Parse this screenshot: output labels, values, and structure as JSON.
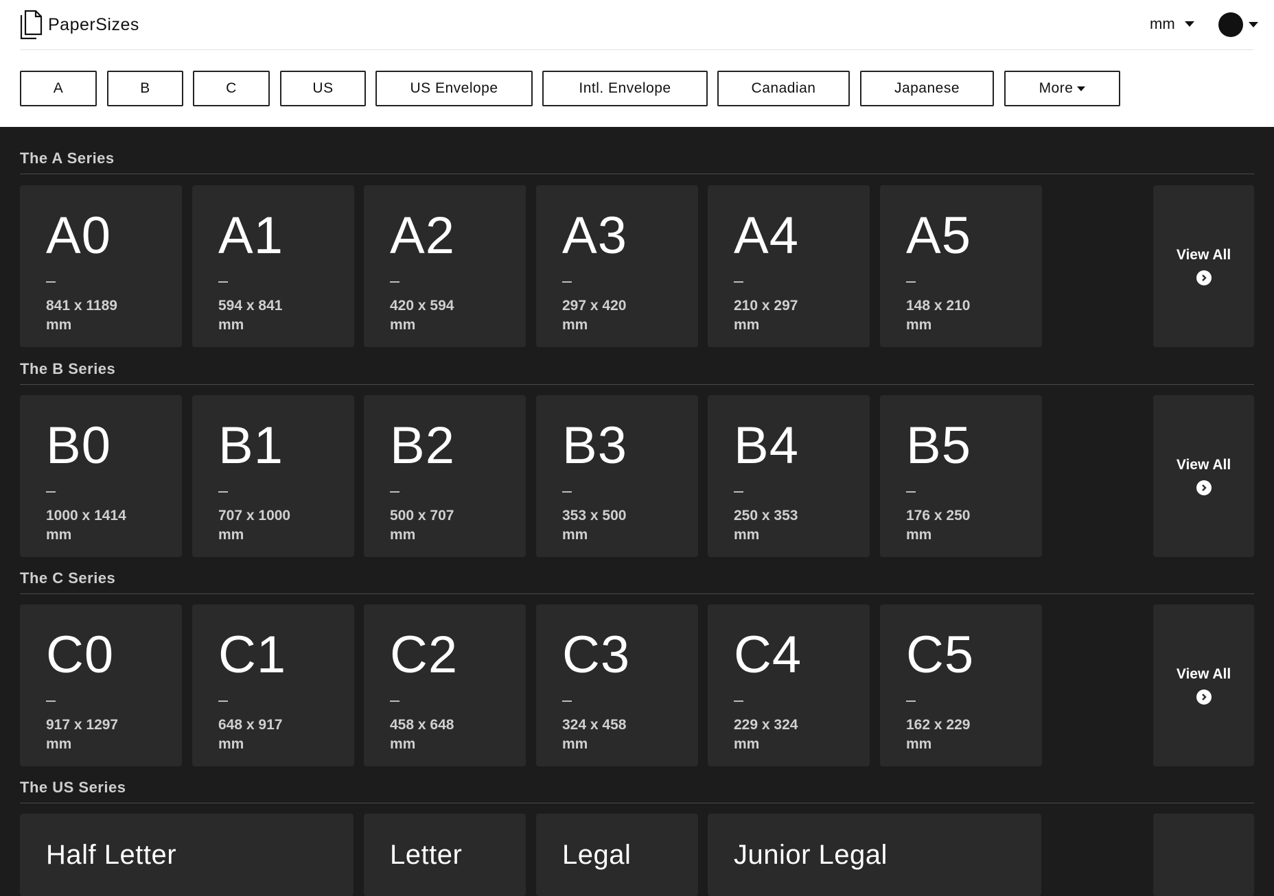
{
  "app": {
    "name": "PaperSizes"
  },
  "header": {
    "unit": "mm",
    "avatar_label": ""
  },
  "nav": [
    "A",
    "B",
    "C",
    "US",
    "US Envelope",
    "Intl. Envelope",
    "Canadian",
    "Japanese",
    "More"
  ],
  "sections": [
    {
      "title": "The A Series",
      "items": [
        {
          "name": "A0",
          "dims": "841 x 1189",
          "unit": "mm"
        },
        {
          "name": "A1",
          "dims": "594 x 841",
          "unit": "mm"
        },
        {
          "name": "A2",
          "dims": "420 x 594",
          "unit": "mm"
        },
        {
          "name": "A3",
          "dims": "297 x 420",
          "unit": "mm"
        },
        {
          "name": "A4",
          "dims": "210 x 297",
          "unit": "mm"
        },
        {
          "name": "A5",
          "dims": "148 x 210",
          "unit": "mm"
        }
      ],
      "view_all": "View All"
    },
    {
      "title": "The B Series",
      "items": [
        {
          "name": "B0",
          "dims": "1000 x 1414",
          "unit": "mm"
        },
        {
          "name": "B1",
          "dims": "707 x 1000",
          "unit": "mm"
        },
        {
          "name": "B2",
          "dims": "500 x 707",
          "unit": "mm"
        },
        {
          "name": "B3",
          "dims": "353 x 500",
          "unit": "mm"
        },
        {
          "name": "B4",
          "dims": "250 x 353",
          "unit": "mm"
        },
        {
          "name": "B5",
          "dims": "176 x 250",
          "unit": "mm"
        }
      ],
      "view_all": "View All"
    },
    {
      "title": "The C Series",
      "items": [
        {
          "name": "C0",
          "dims": "917 x 1297",
          "unit": "mm"
        },
        {
          "name": "C1",
          "dims": "648 x 917",
          "unit": "mm"
        },
        {
          "name": "C2",
          "dims": "458 x 648",
          "unit": "mm"
        },
        {
          "name": "C3",
          "dims": "324 x 458",
          "unit": "mm"
        },
        {
          "name": "C4",
          "dims": "229 x 324",
          "unit": "mm"
        },
        {
          "name": "C5",
          "dims": "162 x 229",
          "unit": "mm"
        }
      ],
      "view_all": "View All"
    },
    {
      "title": "The US Series",
      "items": [
        {
          "name": "Half Letter"
        },
        {
          "name": "Letter"
        },
        {
          "name": "Legal"
        },
        {
          "name": "Junior Legal"
        }
      ]
    }
  ]
}
